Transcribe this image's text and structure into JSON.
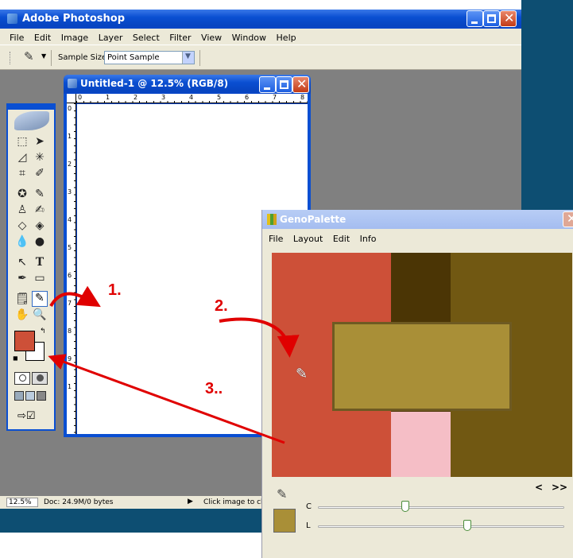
{
  "photoshop": {
    "title": "Adobe Photoshop",
    "menu": [
      "File",
      "Edit",
      "Image",
      "Layer",
      "Select",
      "Filter",
      "View",
      "Window",
      "Help"
    ],
    "options": {
      "sample_size_label": "Sample Size:",
      "sample_size_value": "Point Sample"
    },
    "document": {
      "title": "Untitled-1 @ 12.5% (RGB/8)",
      "ruler_h": [
        "0",
        "1",
        "2",
        "3",
        "4",
        "5",
        "6",
        "7",
        "8"
      ],
      "ruler_v": [
        "0",
        "1",
        "2",
        "3",
        "4",
        "5",
        "6",
        "7",
        "8",
        "9",
        "1"
      ]
    },
    "status": {
      "zoom": "12.5%",
      "doc": "Doc: 24.9M/0 bytes",
      "hint": "Click image to cho"
    },
    "foreground_color": "#cd5038",
    "background_color": "#ffffff"
  },
  "genopalette": {
    "title": "GenoPalette",
    "menu": [
      "File",
      "Layout",
      "Edit",
      "Info"
    ],
    "colors": {
      "red": "#cd5038",
      "dark_brown": "#4b3505",
      "olive": "#715812",
      "gold": "#a98f37",
      "gold_border": "#6e5a22",
      "pink": "#f5bec6"
    },
    "nav": {
      "prev": "<",
      "next": ">>"
    },
    "sliders": [
      {
        "label": "C",
        "value": 0.35
      },
      {
        "label": "L",
        "value": 0.6
      }
    ],
    "swatch_color": "#a98f37"
  },
  "annotations": {
    "step1": "1.",
    "step2": "2.",
    "step3": "3.."
  }
}
